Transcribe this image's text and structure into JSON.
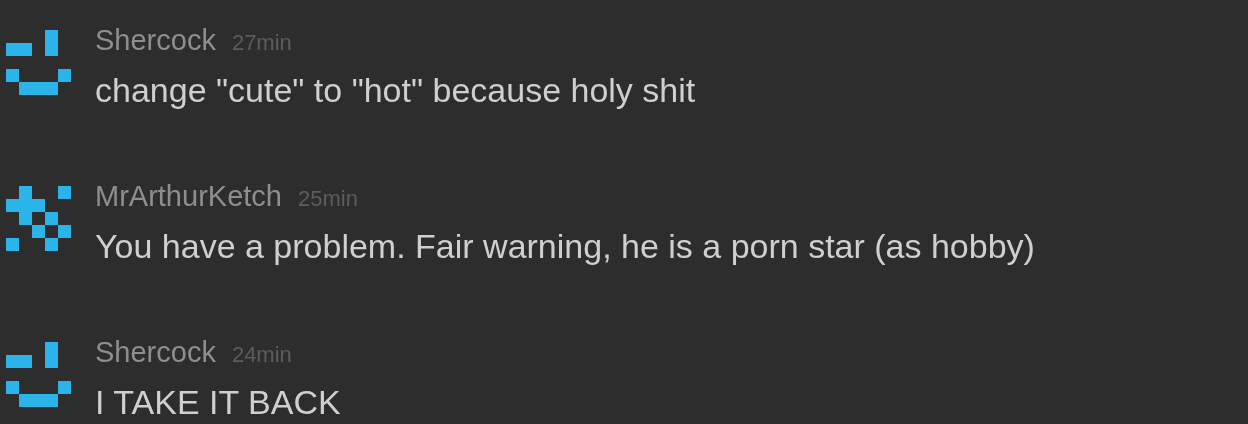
{
  "comments": [
    {
      "avatar": {
        "kind": "smiley"
      },
      "author": "Shercock",
      "time": "27min",
      "text": "change \"cute\" to \"hot\" because holy shit"
    },
    {
      "avatar": {
        "kind": "cross"
      },
      "author": "MrArthurKetch",
      "time": "25min",
      "text": "You have a problem. Fair warning, he is a porn star (as hobby)"
    },
    {
      "avatar": {
        "kind": "smiley"
      },
      "author": "Shercock",
      "time": "24min",
      "text": "I TAKE IT BACK"
    }
  ]
}
